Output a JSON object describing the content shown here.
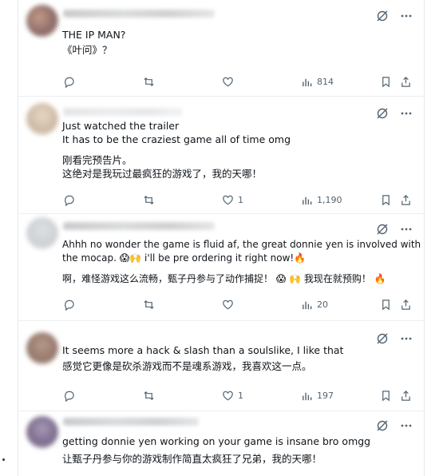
{
  "tweets": [
    {
      "lines": [
        "THE IP MAN?",
        "《叶问》？"
      ],
      "views": "814",
      "replies": "",
      "reposts": "",
      "likes": ""
    },
    {
      "lines": [
        "Just watched the trailer",
        "It has to be the craziest game all of time omg",
        "",
        "刚看完预告片。",
        "这绝对是我玩过最疯狂的游戏了，我的天哪！"
      ],
      "views": "1,190",
      "replies": "",
      "reposts": "",
      "likes": "1"
    },
    {
      "lines": [
        "Ahhh no wonder the game is fluid af, the great donnie yen is involved with",
        "the mocap. 😱🙌 i'll be pre ordering it right now!🔥",
        "",
        "啊，难怪游戏这么流畅，甄子丹参与了动作捕捉！ 😱 🙌  我现在就预购！ 🔥"
      ],
      "views": "20",
      "replies": "",
      "reposts": "",
      "likes": ""
    },
    {
      "lines": [
        "It seems more a hack & slash than a soulslike, I like that",
        "感觉它更像是砍杀游戏而不是魂系游戏，我喜欢这一点。"
      ],
      "views": "197",
      "replies": "",
      "reposts": "",
      "likes": "1"
    },
    {
      "lines": [
        "getting donnie yen working on your game is insane bro omgg",
        "让甄子丹参与你的游戏制作简直太疯狂了兄弟，我的天哪！"
      ],
      "views": "",
      "replies": "",
      "reposts": "",
      "likes": ""
    }
  ],
  "icons": {
    "reply": "reply-icon",
    "repost": "repost-icon",
    "like": "heart-icon",
    "views": "views-icon",
    "bookmark": "bookmark-icon",
    "share": "share-icon",
    "grok": "grok-icon",
    "more": "more-icon"
  },
  "colors": {
    "text": "#0f1419",
    "muted": "#536471",
    "border": "#eceef0"
  }
}
